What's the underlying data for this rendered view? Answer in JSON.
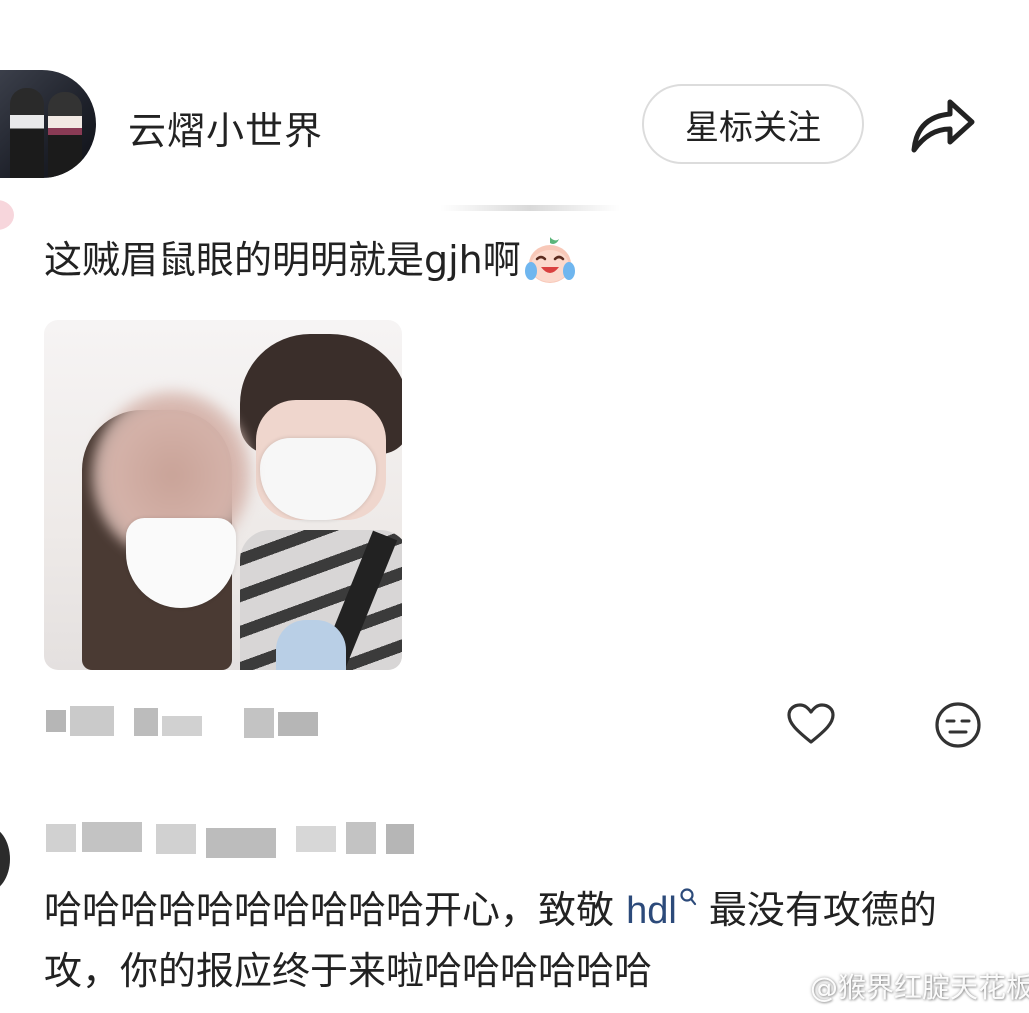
{
  "header": {
    "username": "云熠小世界",
    "follow_label": "星标关注"
  },
  "post": {
    "text": "这贼眉鼠眼的明明就是gjh啊",
    "emoji": "crying-laughing-peach-emoji"
  },
  "comment": {
    "text_before": "哈哈哈哈哈哈哈哈哈哈开心，致敬 ",
    "link_text": "hdl",
    "text_after": " 最没有攻德的攻，你的报应终于来啦哈哈哈哈哈哈"
  },
  "watermark": {
    "text": "@猴界红腚天花板"
  },
  "icons": {
    "share": "share-icon",
    "like": "heart-icon",
    "react": "neutral-face-icon",
    "link": "search-icon",
    "watermark": "weibo-icon"
  },
  "colors": {
    "link": "#2c4a7a",
    "button_border": "#dcdcdc",
    "text": "#222222"
  }
}
